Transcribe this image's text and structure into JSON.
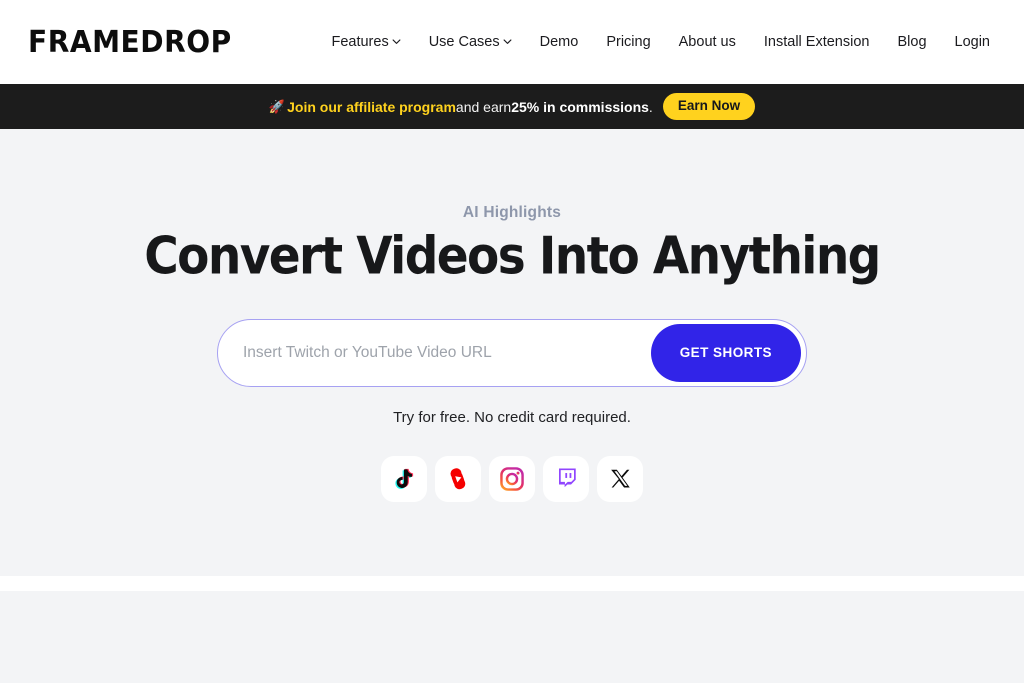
{
  "brand": {
    "name": "FRAMEDROP"
  },
  "nav": {
    "items": [
      {
        "label": "Features",
        "has_dropdown": true,
        "icon": "chevron-down-icon"
      },
      {
        "label": "Use Cases",
        "has_dropdown": true,
        "icon": "chevron-down-icon"
      },
      {
        "label": "Demo",
        "has_dropdown": false
      },
      {
        "label": "Pricing",
        "has_dropdown": false
      },
      {
        "label": "About us",
        "has_dropdown": false
      },
      {
        "label": "Install Extension",
        "has_dropdown": false
      },
      {
        "label": "Blog",
        "has_dropdown": false
      },
      {
        "label": "Login",
        "has_dropdown": false
      }
    ]
  },
  "banner": {
    "icon": "rocket-icon",
    "rocket": "🚀",
    "accent_text": "Join our affiliate program",
    "middle_text": " and earn ",
    "strong_text": "25% in commissions",
    "end_text": ".",
    "cta_label": "Earn Now",
    "background": "#1c1c1c",
    "accent_color": "#FFD21E"
  },
  "hero": {
    "eyebrow": "AI Highlights",
    "headline": "Convert Videos Into Anything",
    "url_field": {
      "placeholder": "Insert Twitch or YouTube Video URL",
      "value": ""
    },
    "submit_label": "GET SHORTS",
    "submit_color": "#3124e8",
    "border_color": "#a6a1f2",
    "subnote": "Try for free. No credit card required.",
    "background": "#f3f4f6"
  },
  "socials": {
    "items": [
      {
        "name": "tiktok-icon",
        "label": "TikTok"
      },
      {
        "name": "youtube-shorts-icon",
        "label": "YouTube Shorts"
      },
      {
        "name": "instagram-icon",
        "label": "Instagram"
      },
      {
        "name": "twitch-icon",
        "label": "Twitch"
      },
      {
        "name": "x-icon",
        "label": "X"
      }
    ]
  }
}
